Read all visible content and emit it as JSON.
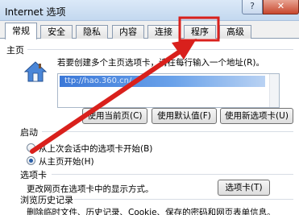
{
  "window": {
    "title": "Internet 选项",
    "help_glyph": "?",
    "close_glyph": "✕"
  },
  "tabs": [
    {
      "label": "常规",
      "active": true
    },
    {
      "label": "安全",
      "active": false
    },
    {
      "label": "隐私",
      "active": false
    },
    {
      "label": "内容",
      "active": false
    },
    {
      "label": "连接",
      "active": false
    },
    {
      "label": "程序",
      "active": false
    },
    {
      "label": "高级",
      "active": false
    }
  ],
  "homepage": {
    "section": "主页",
    "instruction": "若要创建多个主页选项卡，请在每行输入一个地址(R)。",
    "url_value": "ttp://hao.360.cn/",
    "buttons": {
      "current": "使用当前页(C)",
      "default": "使用默认值(F)",
      "new_tab": "使用新选项卡(U)"
    }
  },
  "startup": {
    "section": "启动",
    "options": [
      {
        "label": "从上次会话中的选项卡开始(B)",
        "checked": false
      },
      {
        "label": "从主页开始(H)",
        "checked": true
      }
    ]
  },
  "tabs_section": {
    "section": "选项卡",
    "description": "更改网页在选项卡中的显示方式。",
    "button": "选项卡(T)"
  },
  "history": {
    "section": "浏览历史记录",
    "description": "删除临时文件、历史记录、Cookie、保存的密码和网页表单信息。"
  },
  "colors": {
    "annotation_red": "#d9201c",
    "titlebar": "#c9dbf0",
    "selection": "#3b78d8"
  }
}
